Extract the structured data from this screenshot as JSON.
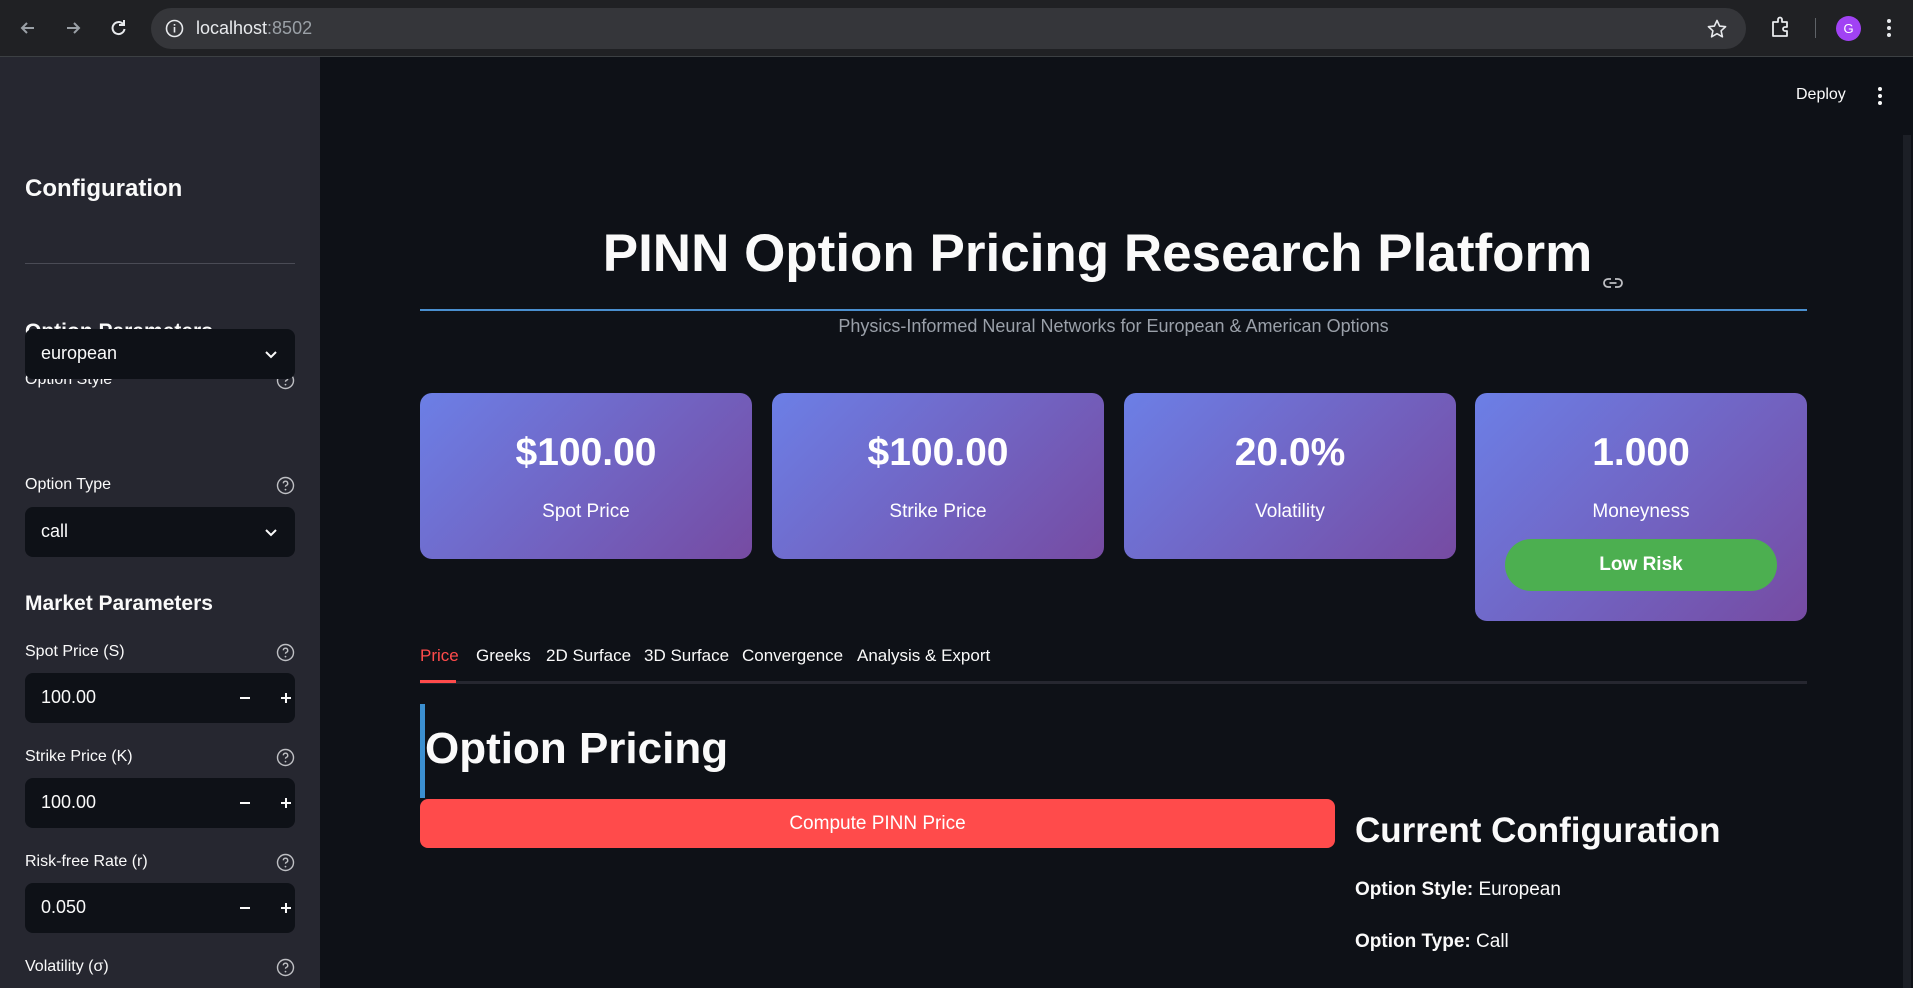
{
  "browser": {
    "url_host": "localhost",
    "url_port": ":8502",
    "profile_initial": "G"
  },
  "header": {
    "deploy_label": "Deploy"
  },
  "sidebar": {
    "title": "Configuration",
    "option_section": "Option Parameters",
    "option_style": {
      "label": "Option Style",
      "value": "european"
    },
    "option_type": {
      "label": "Option Type",
      "value": "call"
    },
    "market_section": "Market Parameters",
    "spot": {
      "label": "Spot Price (S)",
      "value": "100.00"
    },
    "strike": {
      "label": "Strike Price (K)",
      "value": "100.00"
    },
    "rate": {
      "label": "Risk-free Rate (r)",
      "value": "0.050"
    },
    "vol": {
      "label": "Volatility (σ)"
    }
  },
  "main": {
    "title": "PINN Option Pricing Research Platform",
    "subtitle": "Physics-Informed Neural Networks for European & American Options",
    "cards": [
      {
        "value": "$100.00",
        "label": "Spot Price"
      },
      {
        "value": "$100.00",
        "label": "Strike Price"
      },
      {
        "value": "20.0%",
        "label": "Volatility"
      },
      {
        "value": "1.000",
        "label": "Moneyness",
        "badge": "Low Risk"
      }
    ],
    "tabs": [
      "Price",
      "Greeks",
      "2D Surface",
      "3D Surface",
      "Convergence",
      "Analysis & Export"
    ],
    "section_title": "Option Pricing",
    "compute_button": "Compute PINN Price",
    "config": {
      "title": "Current Configuration",
      "style_key": "Option Style:",
      "style_value": " European",
      "type_key": "Option Type:",
      "type_value": " Call"
    }
  },
  "colors": {
    "accent": "#ff4b4b",
    "card_gradient_start": "#6c7fe6",
    "card_gradient_end": "#764ba2",
    "risk_badge": "#4caf50"
  }
}
